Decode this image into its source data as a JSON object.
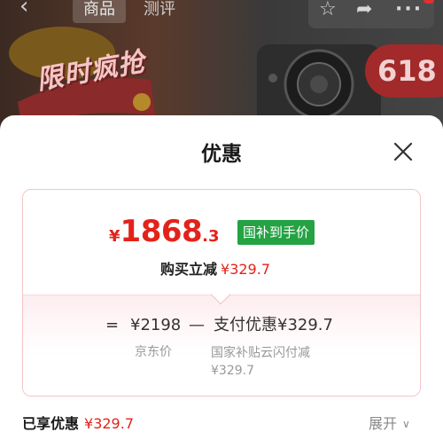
{
  "background": {
    "tabs": [
      {
        "label": "商品",
        "active": true
      },
      {
        "label": "测评",
        "active": false
      }
    ],
    "promo_text": "限时疯抢",
    "badge": "618",
    "icons": [
      "back-icon",
      "star-icon",
      "share-icon",
      "more-icon"
    ]
  },
  "sheet": {
    "title": "优惠",
    "close_icon": "close-icon",
    "final_price": {
      "symbol": "¥",
      "integer": "1868",
      "decimal": ".3"
    },
    "subsidy_tag": "国补到手价",
    "instant_reduce": {
      "label": "购买立减",
      "amount": "¥329.7"
    },
    "formula": {
      "eq": "=",
      "base_amount": "¥2198",
      "minus": "—",
      "pay_label": "支付优惠",
      "pay_amount": "¥329.7"
    },
    "base_label": "京东价",
    "subsidy_desc": {
      "line1": "国家补贴云闪付减",
      "line2": "¥329.7"
    },
    "footer": {
      "enjoyed_label": "已享优惠",
      "enjoyed_amount": "¥329.7",
      "expand_label": "展开"
    }
  },
  "colors": {
    "price_red": "#e2231a",
    "tag_green": "#25a244",
    "card_border": "#f2c3c8"
  }
}
